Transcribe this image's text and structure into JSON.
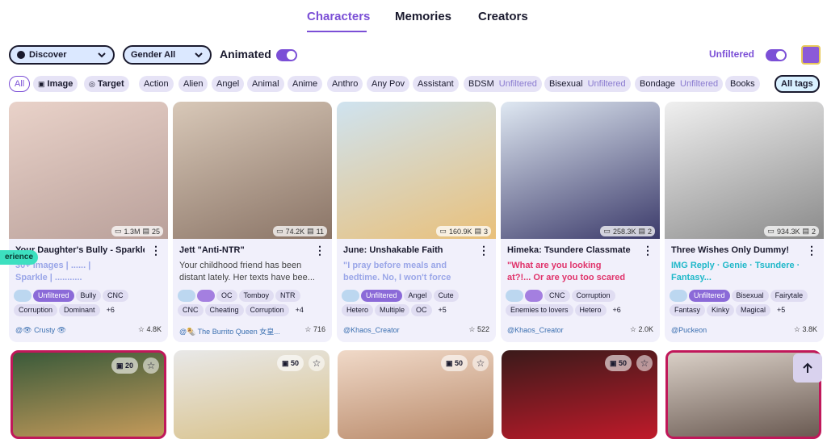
{
  "nav": {
    "tabs": [
      {
        "label": "Characters"
      },
      {
        "label": "Memories"
      },
      {
        "label": "Creators"
      }
    ]
  },
  "filters": {
    "discover": "Discover",
    "gender": "Gender All",
    "animated": "Animated",
    "unfiltered": "Unfiltered"
  },
  "tags": [
    "All",
    "Image",
    "Target",
    "Action",
    "Alien",
    "Angel",
    "Animal",
    "Anime",
    "Anthro",
    "Any Pov",
    "Assistant",
    "BDSM",
    "Bisexual",
    "Bondage",
    "Books"
  ],
  "tag_unfiltered": "Unfiltered",
  "all_tags": "All tags",
  "experience": "erience",
  "cards": [
    {
      "title": "Your Daughter's Bully - Sparkle",
      "stat1": "1.3M",
      "stat2": "25",
      "desc1": "30+ Images  |  ......  |",
      "desc2": "Sparkle  |  ...........",
      "chips": [
        "Unfiltered",
        "Bully",
        "CNC",
        "Corruption",
        "Dominant",
        "+6"
      ],
      "creator": "@👁 Crusty 👁",
      "rating": "4.8K",
      "colors": [
        "#e9d2c9",
        "#b9a09a"
      ]
    },
    {
      "title": "Jett \"Anti-NTR\"",
      "stat1": "74.2K",
      "stat2": "11",
      "desc1": "Your childhood friend has been",
      "desc2": "distant lately. Her texts have bee...",
      "chips": [
        "OC",
        "Tomboy",
        "NTR",
        "CNC",
        "Cheating",
        "Corruption",
        "+4"
      ],
      "creator": "@🌯 The Burrito Queen 女皇...",
      "rating": "716",
      "colors": [
        "#d8c8b8",
        "#8a7466"
      ]
    },
    {
      "title": "June: Unshakable Faith",
      "stat1": "160.9K",
      "stat2": "3",
      "desc1": "\"I pray before meals and",
      "desc2": "bedtime. No, I won't force",
      "chips": [
        "Unfiltered",
        "Angel",
        "Cute",
        "Hetero",
        "Multiple",
        "OC",
        "+5"
      ],
      "creator": "@Khaos_Creator",
      "rating": "522",
      "colors": [
        "#cfe3f0",
        "#e9c07a"
      ]
    },
    {
      "title": "Himeka: Tsundere Classmate",
      "stat1": "258.3K",
      "stat2": "2",
      "desc1": "\"What are you looking",
      "desc2": "at?!... Or are you too scared",
      "chips": [
        "CNC",
        "Corruption",
        "Enemies to lovers",
        "Hetero",
        "+6"
      ],
      "creator": "@Khaos_Creator",
      "rating": "2.0K",
      "colors": [
        "#dfe8f2",
        "#3b3a6a"
      ]
    },
    {
      "title": "Three Wishes Only Dummy!",
      "stat1": "934.3K",
      "stat2": "2",
      "desc1": "IMG Reply · Genie · Tsundere ·",
      "desc2": "Fantasy...",
      "chips": [
        "Unfiltered",
        "Bisexual",
        "Fairytale",
        "Fantasy",
        "Kinky",
        "Magical",
        "+5"
      ],
      "creator": "@Puckeon",
      "rating": "3.8K",
      "colors": [
        "#f0f0f0",
        "#8a8a8a"
      ]
    }
  ],
  "row2": [
    {
      "badge": "20",
      "colors": [
        "#3a5a3a",
        "#c49a5a"
      ]
    },
    {
      "badge": "50",
      "colors": [
        "#e8e8e8",
        "#d9c28a"
      ]
    },
    {
      "badge": "50",
      "colors": [
        "#f0d9c8",
        "#b98a6a"
      ]
    },
    {
      "badge": "50",
      "colors": [
        "#3a1a1a",
        "#c01a2a"
      ]
    },
    {
      "badge": "",
      "colors": [
        "#d9cfc6",
        "#6a5a52"
      ]
    }
  ],
  "colors": {
    "accent": "#7b4fd6",
    "card_bg": "#f1f0fb"
  }
}
